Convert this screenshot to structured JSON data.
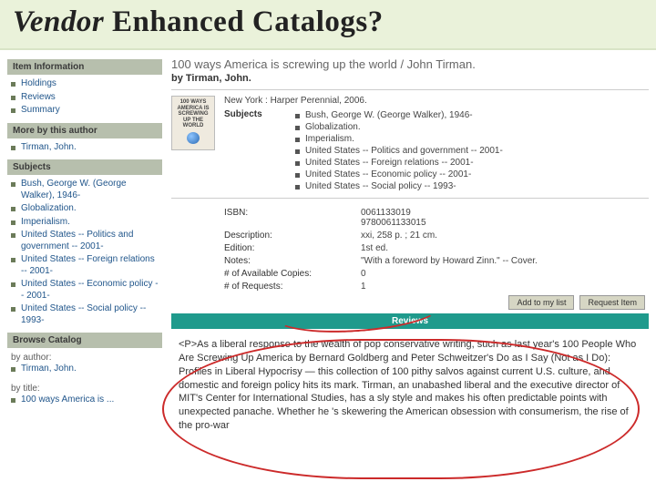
{
  "slide": {
    "title_italic": "Vendor",
    "title_rest": " Enhanced Catalogs?"
  },
  "sidebar": {
    "item_info_header": "Item Information",
    "item_info": [
      {
        "label": "Holdings"
      },
      {
        "label": "Reviews"
      },
      {
        "label": "Summary"
      }
    ],
    "more_by_header": "More by this author",
    "more_by": [
      {
        "label": "Tirman, John."
      }
    ],
    "subjects_header": "Subjects",
    "subjects": [
      {
        "label": "Bush, George W. (George Walker), 1946-"
      },
      {
        "label": "Globalization."
      },
      {
        "label": "Imperialism."
      },
      {
        "label": "United States -- Politics and government -- 2001-"
      },
      {
        "label": "United States -- Foreign relations -- 2001-"
      },
      {
        "label": "United States -- Economic policy -- 2001-"
      },
      {
        "label": "United States -- Social policy -- 1993-"
      }
    ],
    "browse_header": "Browse Catalog",
    "browse_by_author": "by author:",
    "browse_author": [
      {
        "label": "Tirman, John."
      }
    ],
    "browse_by_title": "by title:",
    "browse_title": [
      {
        "label": "100 ways America is ..."
      }
    ]
  },
  "record": {
    "title": "100 ways America is screwing up the world / John Tirman.",
    "byline": "by Tirman, John.",
    "cover_text": "100 WAYS AMERICA IS SCREWING UP THE WORLD",
    "publisher": "New York : Harper Perennial, 2006.",
    "subjects_label": "Subjects",
    "subjects": [
      "Bush, George W. (George Walker), 1946-",
      "Globalization.",
      "Imperialism.",
      "United States -- Politics and government -- 2001-",
      "United States -- Foreign relations -- 2001-",
      "United States -- Economic policy -- 2001-",
      "United States -- Social policy -- 1993-"
    ],
    "meta": {
      "isbn_label": "ISBN:",
      "isbn1": "0061133019",
      "isbn2": "9780061133015",
      "desc_label": "Description:",
      "desc": "xxi, 258 p. ; 21 cm.",
      "edition_label": "Edition:",
      "edition": "1st ed.",
      "notes_label": "Notes:",
      "notes": "\"With a foreword by Howard Zinn.\" -- Cover.",
      "avail_label": "# of Available Copies:",
      "avail": "0",
      "req_label": "# of Requests:",
      "req": "1"
    },
    "add_btn": "Add to my list",
    "request_btn": "Request Item",
    "reviews_header": "Reviews",
    "review_text": "<P>As a liberal response to the wealth of pop conservative writing, such as last year's 100 People Who Are Screwing Up America by Bernard Goldberg and Peter Schweitzer's Do as I Say (Not as I Do): Profiles in Liberal Hypocrisy — this collection of 100 pithy salvos against current U.S. culture, and domestic and foreign policy hits its mark. Tirman, an unabashed liberal and the executive director of MIT's Center for International Studies, has a sly style and makes his often predictable points with unexpected panache. Whether he 's skewering the American obsession with consumerism, the rise of the pro-war"
  }
}
